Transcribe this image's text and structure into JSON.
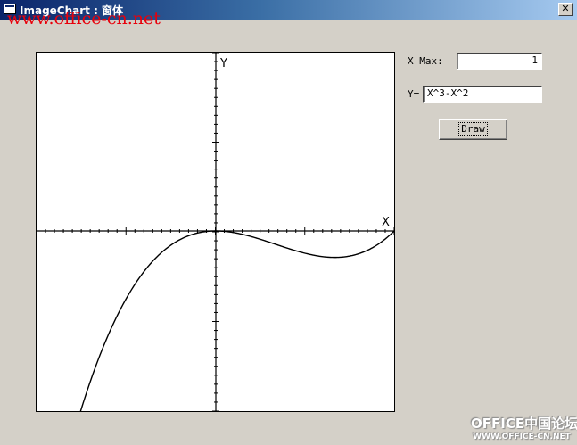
{
  "window": {
    "title": "ImageChart : 窗体",
    "close_glyph": "✕"
  },
  "watermark": "www.office-cn.net",
  "form": {
    "xmax_label": "X Max:",
    "xmax_value": "1",
    "y_label": "Y=",
    "y_value": "X^3-X^2",
    "draw_label": "Draw"
  },
  "chart_data": {
    "type": "line",
    "expression": "X^3-X^2",
    "xlabel": "X",
    "ylabel": "Y",
    "xlim": [
      -1,
      1
    ],
    "ylim": [
      -1,
      1
    ],
    "x_ticks": 40,
    "y_ticks": 40,
    "grid": false
  },
  "logo": {
    "line1": "OFFICE中国论坛",
    "line2": "WWW.OFFICE-CN.NET"
  }
}
